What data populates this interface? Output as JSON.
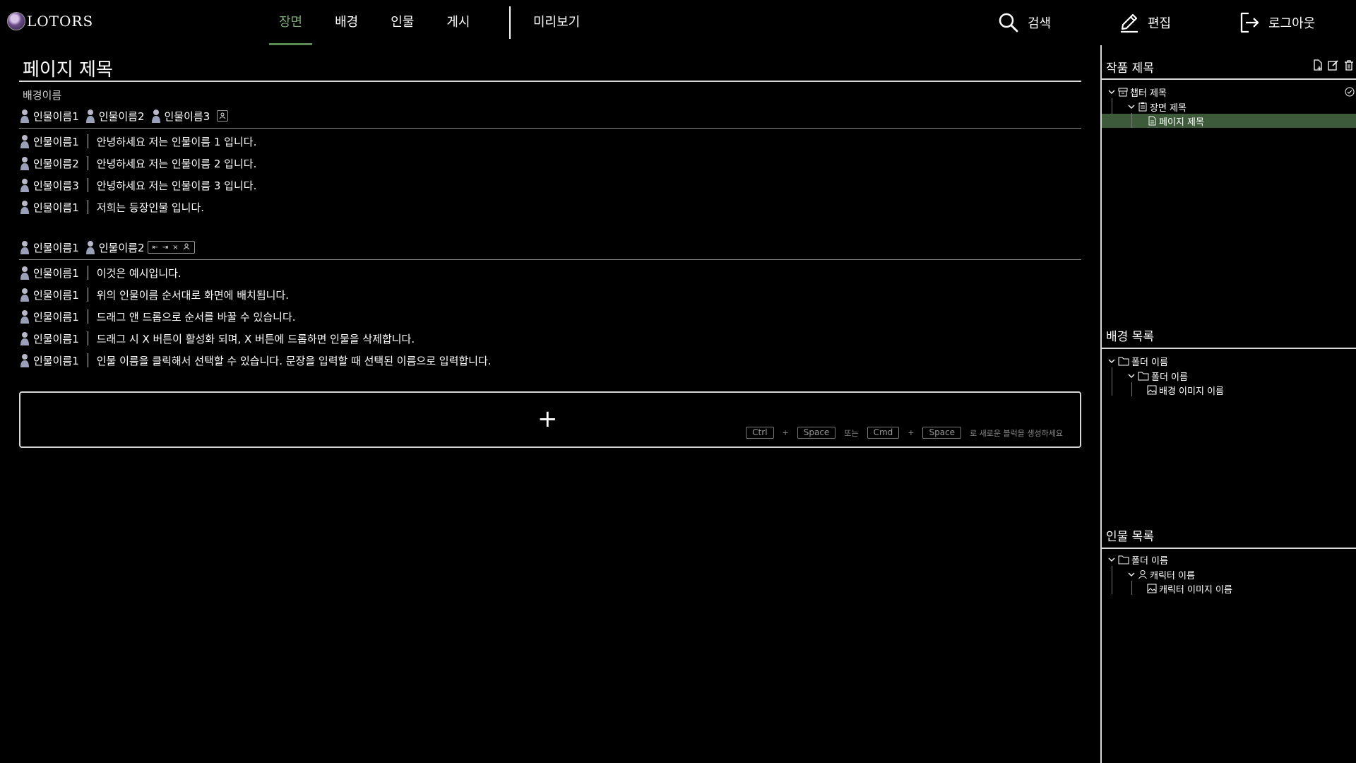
{
  "header": {
    "logo_text": "LOTORS",
    "tabs": [
      "장면",
      "배경",
      "인물",
      "게시"
    ],
    "active_tab": "장면",
    "preview_label": "미리보기",
    "search_label": "검색",
    "edit_label": "편집",
    "logout_label": "로그아웃"
  },
  "page": {
    "title": "페이지 제목",
    "background_name": "배경이름"
  },
  "blocks": [
    {
      "characters": [
        "인물이름1",
        "인물이름2",
        "인물이름3"
      ],
      "lines": [
        {
          "name": "인물이름1",
          "text": "안녕하세요 저는 인물이름 1 입니다."
        },
        {
          "name": "인물이름2",
          "text": "안녕하세요 저는 인물이름 2 입니다."
        },
        {
          "name": "인물이름3",
          "text": "안녕하세요 저는 인물이름 3 입니다."
        },
        {
          "name": "인물이름1",
          "text": "저희는 등장인물 입니다."
        }
      ]
    },
    {
      "characters": [
        "인물이름1",
        "인물이름2"
      ],
      "controls": [
        "⇤",
        "⇥",
        "×",
        "+"
      ],
      "lines": [
        {
          "name": "인물이름1",
          "text": "이것은 예시입니다."
        },
        {
          "name": "인물이름1",
          "text": "위의 인물이름 순서대로 화면에 배치됩니다."
        },
        {
          "name": "인물이름1",
          "text": "드래그 앤 드롭으로 순서를 바꿀 수 있습니다."
        },
        {
          "name": "인물이름1",
          "text": "드래그 시 X 버튼이 활성화 되며, X 버튼에 드롭하면 인물을 삭제합니다."
        },
        {
          "name": "인물이름1",
          "text": "인물 이름을 클릭해서 선택할 수 있습니다. 문장을 입력할 때 선택된 이름으로 입력합니다."
        }
      ]
    }
  ],
  "add_block": {
    "plus": "+",
    "key_ctrl": "Ctrl",
    "key_space": "Space",
    "or_text": "또는",
    "key_cmd": "Cmd",
    "plus_small": "+",
    "hint_text": "로 새로운 블럭을 생성하세요"
  },
  "sidebar": {
    "work_title": "작품 제목",
    "chapter": "챕터 제목",
    "scene": "장면 제목",
    "page": "페이지 제목",
    "bg_list_title": "배경 목록",
    "bg_folder": "폴더 이름",
    "bg_subfolder": "폴더 이름",
    "bg_image": "배경 이미지 이름",
    "char_list_title": "인물 목록",
    "char_folder": "폴더 이름",
    "char_name": "캐릭터 이름",
    "char_image": "캐릭터 이미지 이름"
  },
  "colors": {
    "accent": "#7aa874",
    "selected_bg": "#3d5b3a",
    "background": "#000000"
  }
}
